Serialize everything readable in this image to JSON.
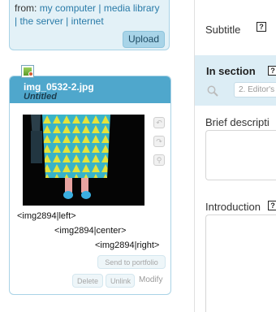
{
  "upload": {
    "from_label": "from:",
    "sources": [
      "my computer",
      "media library",
      "the server",
      "internet"
    ],
    "upload_button": "Upload"
  },
  "image_card": {
    "file_name": "img_0532-2.jpg",
    "title": "Untitled",
    "embed_codes": [
      "<img2894|left>",
      "<img2894|center>",
      "<img2894|right>"
    ],
    "send_to_portfolio": "Send to portfolio",
    "delete": "Delete",
    "unlink": "Unlink",
    "modify": "Modify"
  },
  "form": {
    "subtitle_label": "Subtitle",
    "help_glyph": "?",
    "in_section_label": "In section",
    "in_section_value": "2. Editor's",
    "brief_description_label": "Brief descripti",
    "introduction_label": "Introduction"
  }
}
